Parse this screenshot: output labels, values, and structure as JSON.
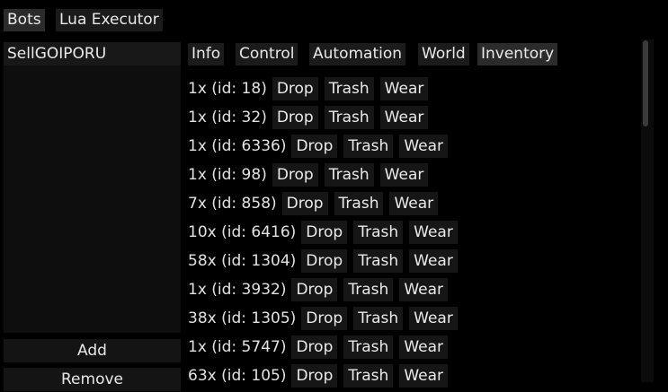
{
  "top_tabs": [
    {
      "label": "Bots",
      "active": true
    },
    {
      "label": "Lua Executor",
      "active": false
    }
  ],
  "sidebar": {
    "bots": [
      "SellGOIPORU"
    ],
    "add_label": "Add",
    "remove_label": "Remove"
  },
  "sub_tabs": [
    {
      "label": "Info",
      "active": false
    },
    {
      "label": "Control",
      "active": false
    },
    {
      "label": "Automation",
      "active": false
    },
    {
      "label": "World",
      "active": false
    },
    {
      "label": "Inventory",
      "active": true
    }
  ],
  "inventory": {
    "drop_label": "Drop",
    "trash_label": "Trash",
    "wear_label": "Wear",
    "items": [
      {
        "text": "1x (id: 18)"
      },
      {
        "text": "1x (id: 32)"
      },
      {
        "text": "1x (id: 6336)"
      },
      {
        "text": "1x (id: 98)"
      },
      {
        "text": "7x (id: 858)"
      },
      {
        "text": "10x (id: 6416)"
      },
      {
        "text": "58x (id: 1304)"
      },
      {
        "text": "1x (id: 3932)"
      },
      {
        "text": "38x (id: 1305)"
      },
      {
        "text": "1x (id: 5747)"
      },
      {
        "text": "63x (id: 105)"
      }
    ]
  },
  "colors": {
    "background": "#000000",
    "tab_active": "#2b2b2b",
    "tab_inactive": "#1b1b1b",
    "text": "#e6e6e6"
  }
}
